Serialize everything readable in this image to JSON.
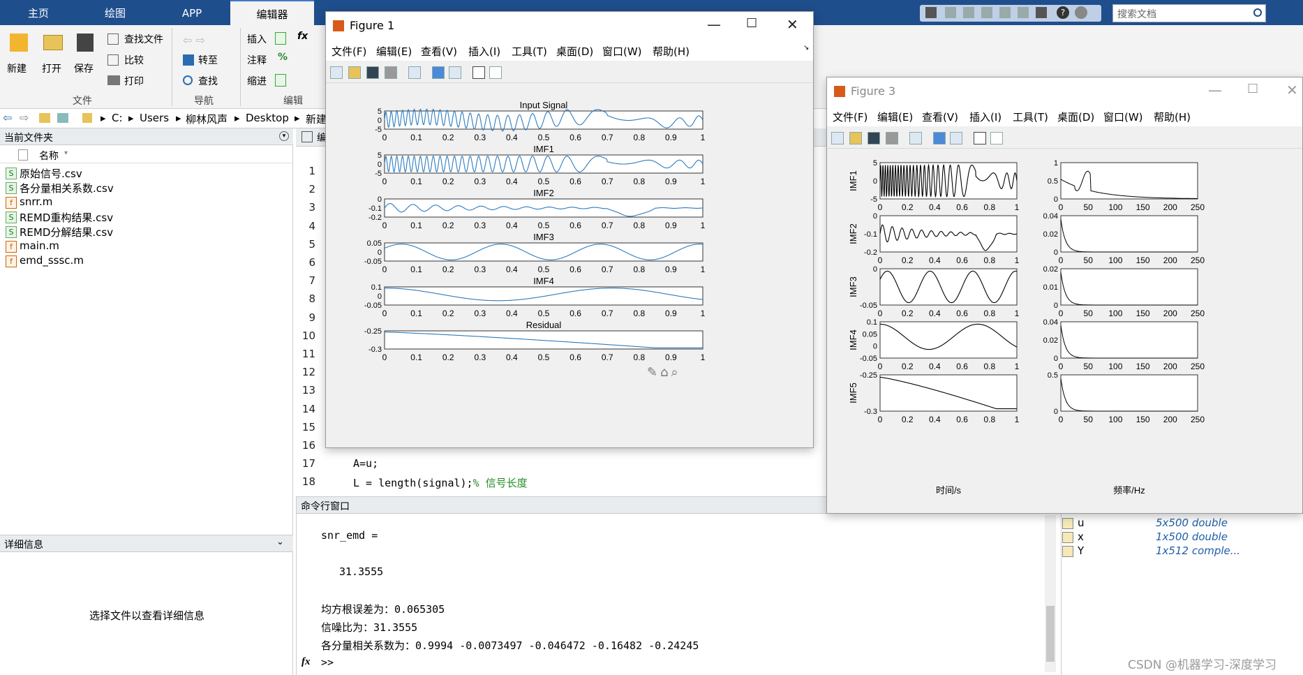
{
  "ribbon_tabs": [
    "主页",
    "绘图",
    "APP",
    "编辑器"
  ],
  "ribbon": {
    "new": "新建",
    "open": "打开",
    "save": "保存",
    "find_files": "查找文件",
    "compare": "比较",
    "print": "打印",
    "group_file": "文件",
    "goto": "转至",
    "find": "查找",
    "group_nav": "导航",
    "insert": "插入",
    "comment": "注释",
    "indent": "缩进",
    "fx": "fx",
    "pct": "%",
    "group_edit": "编辑"
  },
  "search_placeholder": "搜索文档",
  "address": {
    "path": [
      "C:",
      "Users",
      "柳林风声",
      "Desktop",
      "新建"
    ]
  },
  "current_folder": {
    "title": "当前文件夹",
    "col_name": "名称",
    "files": [
      {
        "name": "原始信号.csv",
        "type": "csv"
      },
      {
        "name": "各分量相关系数.csv",
        "type": "csv"
      },
      {
        "name": "snrr.m",
        "type": "m"
      },
      {
        "name": "REMD重构结果.csv",
        "type": "csv"
      },
      {
        "name": "REMD分解结果.csv",
        "type": "csv"
      },
      {
        "name": "main.m",
        "type": "m"
      },
      {
        "name": "emd_sssc.m",
        "type": "m"
      }
    ]
  },
  "details": {
    "title": "详细信息",
    "message": "选择文件以查看详细信息"
  },
  "editor": {
    "tab_fragment": "编",
    "line_numbers": [
      "1",
      "2",
      "3",
      "4",
      "5",
      "6",
      "7",
      "8",
      "9",
      "10",
      "11",
      "12",
      "13",
      "14",
      "15",
      "16",
      "17",
      "18"
    ],
    "line17": "A=u;",
    "line18_code": "L = length(signal);",
    "line18_comment": "% 信号长度"
  },
  "command_window": {
    "title": "命令行窗口",
    "lines": [
      "snr_emd =",
      "31.3555",
      "均方根误差为：0.065305",
      "信噪比为：31.3555",
      "各分量相关系数为：0.9994   -0.0073497    -0.046472     -0.16482     -0.24245"
    ],
    "prompt_icon": "fx",
    "prompt": ">>"
  },
  "workspace": {
    "rows": [
      {
        "name": "u",
        "value": "5x500 double"
      },
      {
        "name": "x",
        "value": "1x500 double"
      },
      {
        "name": "Y",
        "value": "1x512 comple..."
      }
    ]
  },
  "figure1": {
    "title": "Figure 1",
    "menu": [
      "文件(F)",
      "编辑(E)",
      "查看(V)",
      "插入(I)",
      "工具(T)",
      "桌面(D)",
      "窗口(W)",
      "帮助(H)"
    ],
    "xticks": [
      "0",
      "0.1",
      "0.2",
      "0.3",
      "0.4",
      "0.5",
      "0.6",
      "0.7",
      "0.8",
      "0.9",
      "1"
    ],
    "plots": [
      {
        "title": "Input Signal",
        "yticks": [
          "5",
          "0",
          "-5"
        ]
      },
      {
        "title": "IMF1",
        "yticks": [
          "5",
          "0",
          "-5"
        ]
      },
      {
        "title": "IMF2",
        "yticks": [
          "0",
          "-0.1",
          "-0.2"
        ]
      },
      {
        "title": "IMF3",
        "yticks": [
          "0.05",
          "0",
          "-0.05"
        ]
      },
      {
        "title": "IMF4",
        "yticks": [
          "0.1",
          "0",
          "-0.05"
        ]
      },
      {
        "title": "Residual",
        "yticks": [
          "-0.25",
          "-0.3"
        ]
      }
    ]
  },
  "figure3": {
    "title": "Figure 3",
    "menu": [
      "文件(F)",
      "编辑(E)",
      "查看(V)",
      "插入(I)",
      "工具(T)",
      "桌面(D)",
      "窗口(W)",
      "帮助(H)"
    ],
    "time_xticks": [
      "0",
      "0.2",
      "0.4",
      "0.6",
      "0.8",
      "1"
    ],
    "freq_xticks": [
      "0",
      "50",
      "100",
      "150",
      "200",
      "250"
    ],
    "xlabel_time": "时间/s",
    "xlabel_freq": "频率/Hz",
    "rows": [
      {
        "ylabel": "IMF1",
        "yticks": [
          "5",
          "0",
          "-5"
        ],
        "fticks": [
          "1",
          "0.5",
          "0"
        ]
      },
      {
        "ylabel": "IMF2",
        "yticks": [
          "0",
          "-0.1",
          "-0.2"
        ],
        "fticks": [
          "0.04",
          "0.02",
          "0"
        ]
      },
      {
        "ylabel": "IMF3",
        "yticks": [
          "0",
          "-0.05"
        ],
        "fticks": [
          "0.02",
          "0.01",
          "0"
        ]
      },
      {
        "ylabel": "IMF4",
        "yticks": [
          "0.1",
          "0.05",
          "0",
          "-0.05"
        ],
        "fticks": [
          "0.04",
          "0.02",
          "0"
        ]
      },
      {
        "ylabel": "IMF5",
        "yticks": [
          "-0.25",
          "-0.3"
        ],
        "fticks": [
          "0.5",
          "0"
        ]
      }
    ]
  },
  "watermark": "CSDN @机器学习-深度学习"
}
